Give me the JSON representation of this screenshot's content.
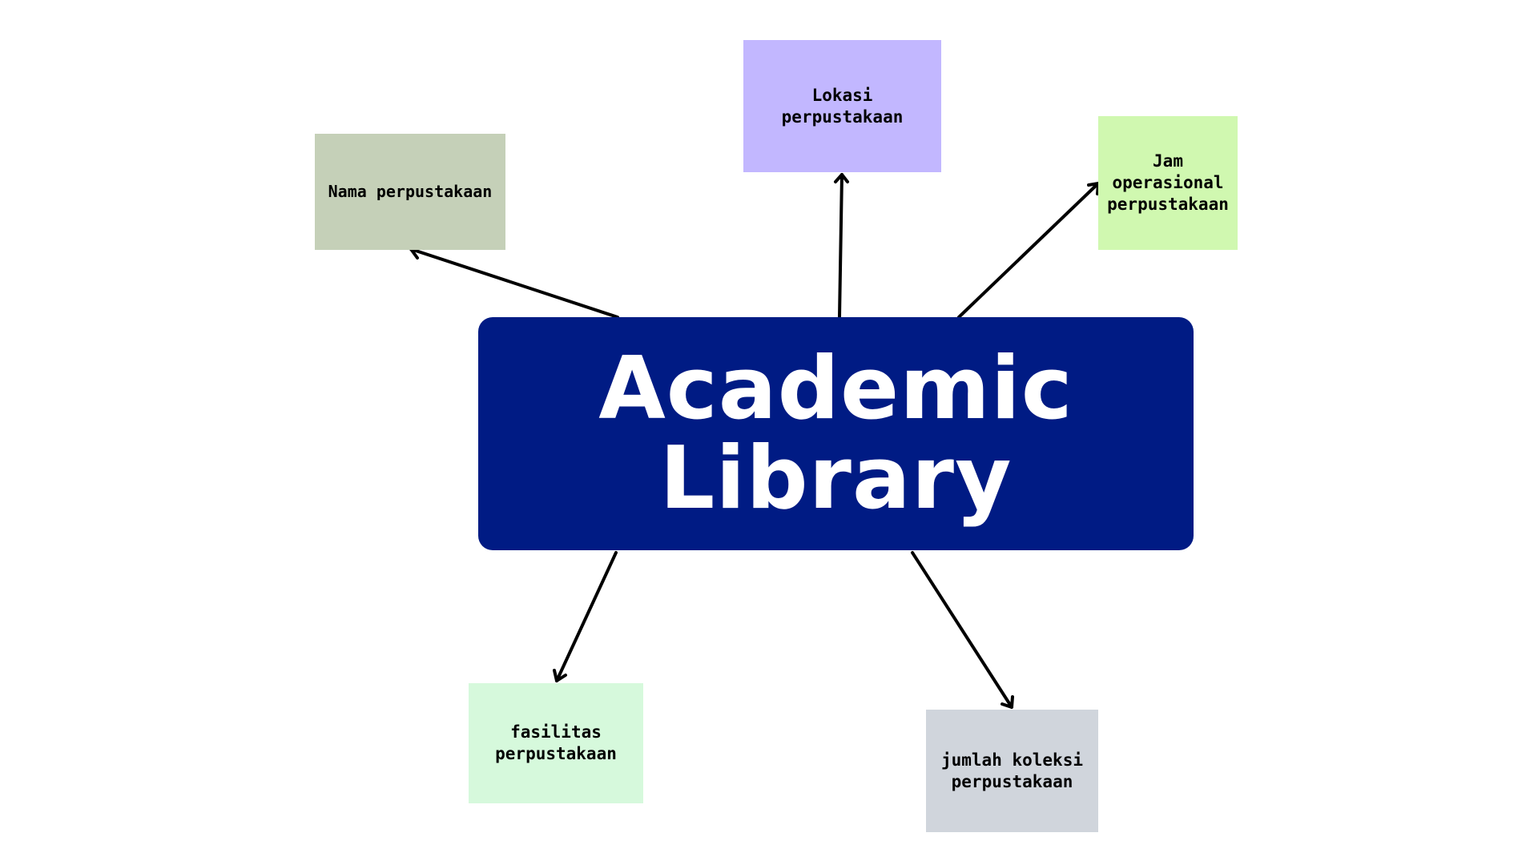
{
  "center": {
    "title": "Academic Library",
    "color": "#001b84"
  },
  "nodes": {
    "lokasi": {
      "label": "Lokasi perpustakaan",
      "color": "#c2b7ff"
    },
    "nama": {
      "label": "Nama perpustakaan",
      "color": "#c5d0b8"
    },
    "jam": {
      "label": "Jam operasional perpustakaan",
      "color": "#d0f8b0"
    },
    "fasilitas": {
      "label": "fasilitas perpustakaan",
      "color": "#d6f9dc"
    },
    "jumlah": {
      "label": "jumlah koleksi perpustakaan",
      "color": "#d0d5dc"
    }
  },
  "edge_color": "#000000"
}
